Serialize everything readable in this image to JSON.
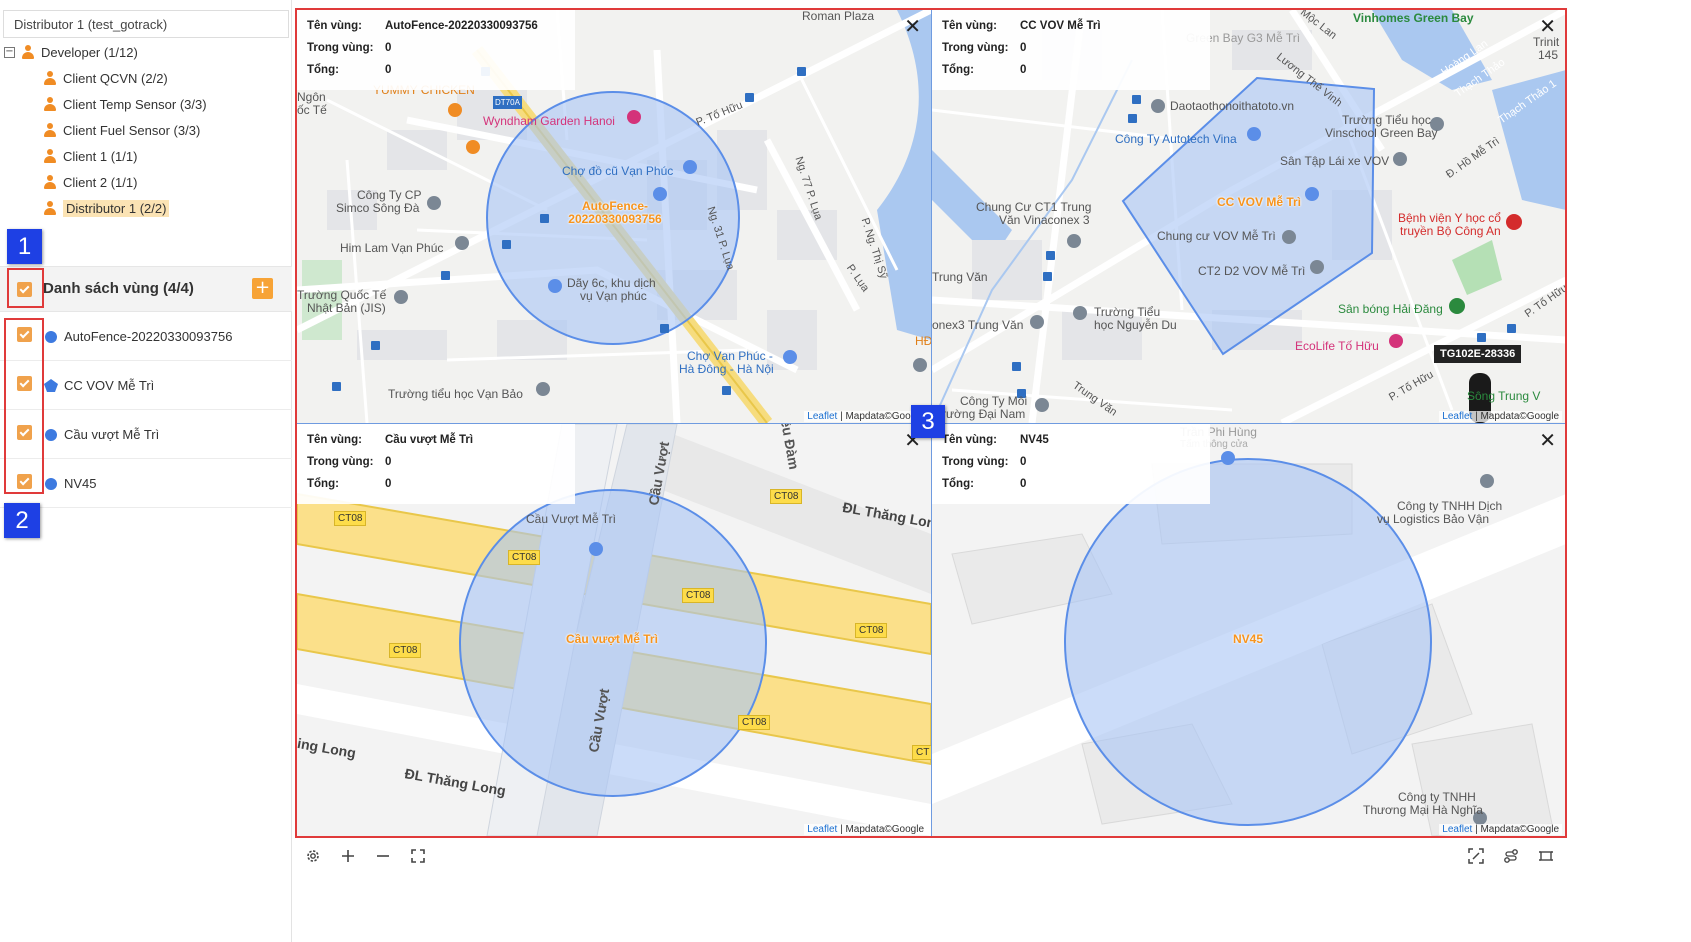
{
  "sidebar": {
    "distributor_header": "Distributor 1 (test_gotrack)",
    "tree": [
      {
        "label": "Developer (1/12)",
        "expander": "−"
      },
      {
        "label": "Client QCVN (2/2)"
      },
      {
        "label": "Client Temp Sensor (3/3)"
      },
      {
        "label": "Client Fuel Sensor (3/3)"
      },
      {
        "label": "Client 1 (1/1)"
      },
      {
        "label": "Client 2 (1/1)"
      },
      {
        "label": "Distributor 1 (2/2)"
      }
    ],
    "zone_list": {
      "title": "Danh sách vùng (4/4)",
      "add_label": "+",
      "items": [
        {
          "label": "AutoFence-20220330093756",
          "shape": "circle"
        },
        {
          "label": "CC VOV Mễ Trì",
          "shape": "polygon"
        },
        {
          "label": "Cầu vượt Mễ Trì",
          "shape": "circle"
        },
        {
          "label": "NV45",
          "shape": "circle"
        }
      ]
    }
  },
  "annotations": {
    "tag1": "1",
    "tag2": "2",
    "tag3": "3"
  },
  "info_labels": {
    "name": "Tên vùng:",
    "inside": "Trong vùng:",
    "total": "Tổng:"
  },
  "panels": [
    {
      "zone_name": "AutoFence-20220330093756",
      "inside": "0",
      "total": "0",
      "map_zone_label_1": "AutoFence-",
      "map_zone_label_2": "20220330093756",
      "places": {
        "p1": "Roman Plaza",
        "p2": "Ngôn",
        "p3": "ốc Tế",
        "p4": "YUMMY CHICKEN",
        "p5": "DT70A",
        "p6": "Wyndham Garden Hanoi",
        "p7": "P. Tố Hữu",
        "p8": "Chợ đồ cũ Vạn Phúc",
        "p9": "Công Ty CP",
        "p10": "Simco Sông Đà",
        "p11": "Ng. 77 P. Lụa",
        "p12": "Ng. 31 P. Lụa",
        "p13": "P. Ng. Thị Sỹ",
        "p14": "P. Lụa",
        "p15": "Him Lam Vạn Phúc",
        "p16": "Dãy 6c, khu dịch",
        "p17": "vụ Vạn phúc",
        "p18": "Trường Quốc Tế",
        "p19": "Nhật Bản (JIS)",
        "p20": "Chợ Vạn Phúc -",
        "p21": "Hà Đông - Hà Nội",
        "p22": "Trường tiểu học Vạn Bảo",
        "p23": "HĐ"
      }
    },
    {
      "zone_name": "CC VOV Mễ Trì",
      "inside": "0",
      "total": "0",
      "map_zone_label_1": "CC VOV Mễ Trì",
      "device_label": "TG102E-28336",
      "places": {
        "p1": "Vinhomes Green Bay",
        "p2": "Green Bay G3 Mễ Trì",
        "p3": "Mộc Lan",
        "p4": "Trinit",
        "p5": "145",
        "p6": "Hoàng Lan",
        "p7": "Thạch Thảo",
        "p8": "Lương Thế Vinh",
        "p9": "Daotaothonoithatoto.vn",
        "p10": "Thạch Thảo 1",
        "p11": "Công Ty Autotech Vina",
        "p12": "Trường Tiểu học",
        "p13": "Vinschool Green Bay",
        "p14": "Sân Tập Lái xe VOV",
        "p15": "Đ. Hồ Mễ Trì",
        "p16": "Chung Cư CT1 Trung",
        "p17": "Văn Vinaconex 3",
        "p18": "Bệnh viện Y học cổ",
        "p19": "truyền Bộ Công An",
        "p20": "Chung cư VOV Mễ Trì",
        "p21": "Trung Văn",
        "p22": "CT2 D2 VOV Mễ Trì",
        "p23": "Trường Tiểu",
        "p24": "học Nguyễn Du",
        "p25": "onex3 Trung Văn",
        "p26": "Sân bóng Hải Đăng",
        "p27": "P. Tố Hữu",
        "p28": "EcoLife Tố Hữu",
        "p29": "Công Ty Môi",
        "p30": "rường Đại Nam",
        "p31": "Trung Văn",
        "p32": "Sông Trung V",
        "p33": "P. Tố Hữu"
      }
    },
    {
      "zone_name": "Cầu vượt Mễ Trì",
      "inside": "0",
      "total": "0",
      "map_zone_label_1": "Cầu vượt Mễ Trì",
      "places": {
        "p1": "Cầu Vượt",
        "p2": "iều Đàm",
        "p3": "Cầu Vượt Mễ Trì",
        "p4": "ĐL Thăng Lon",
        "p5": "Cầu Vượt",
        "p6": "ing Long",
        "p7": "ĐL Thăng Long"
      },
      "road_tags": [
        "CT08",
        "CT08",
        "CT08",
        "CT08",
        "CT08",
        "CT08",
        "CT08",
        "CT"
      ]
    },
    {
      "zone_name": "NV45",
      "inside": "0",
      "total": "0",
      "map_zone_label_1": "NV45",
      "places": {
        "p1": "Trần Phi Hùng",
        "p2": "Tấm thông cửa",
        "p3": "Công ty TNHH Dịch",
        "p4": "vụ Logistics Bảo Vận",
        "p5": "Công ty TNHH",
        "p6": "Thương Mại Hà Nghĩa"
      }
    }
  ],
  "attribution": {
    "leaflet": "Leaflet",
    "sep": " | ",
    "mapdata": "Mapdata©Google"
  },
  "colors": {
    "accent": "#f7a336",
    "zone_fill": "#a9c4f5",
    "zone_stroke": "#5b8ee8",
    "annotation_red": "#e03a3a",
    "annotation_blue": "#1e40e4"
  },
  "toolbar_icons": [
    "gear-icon",
    "zoom-in-icon",
    "zoom-out-icon",
    "fullscreen-icon",
    "fit-bounds-icon",
    "route-icon",
    "layout-icon"
  ]
}
